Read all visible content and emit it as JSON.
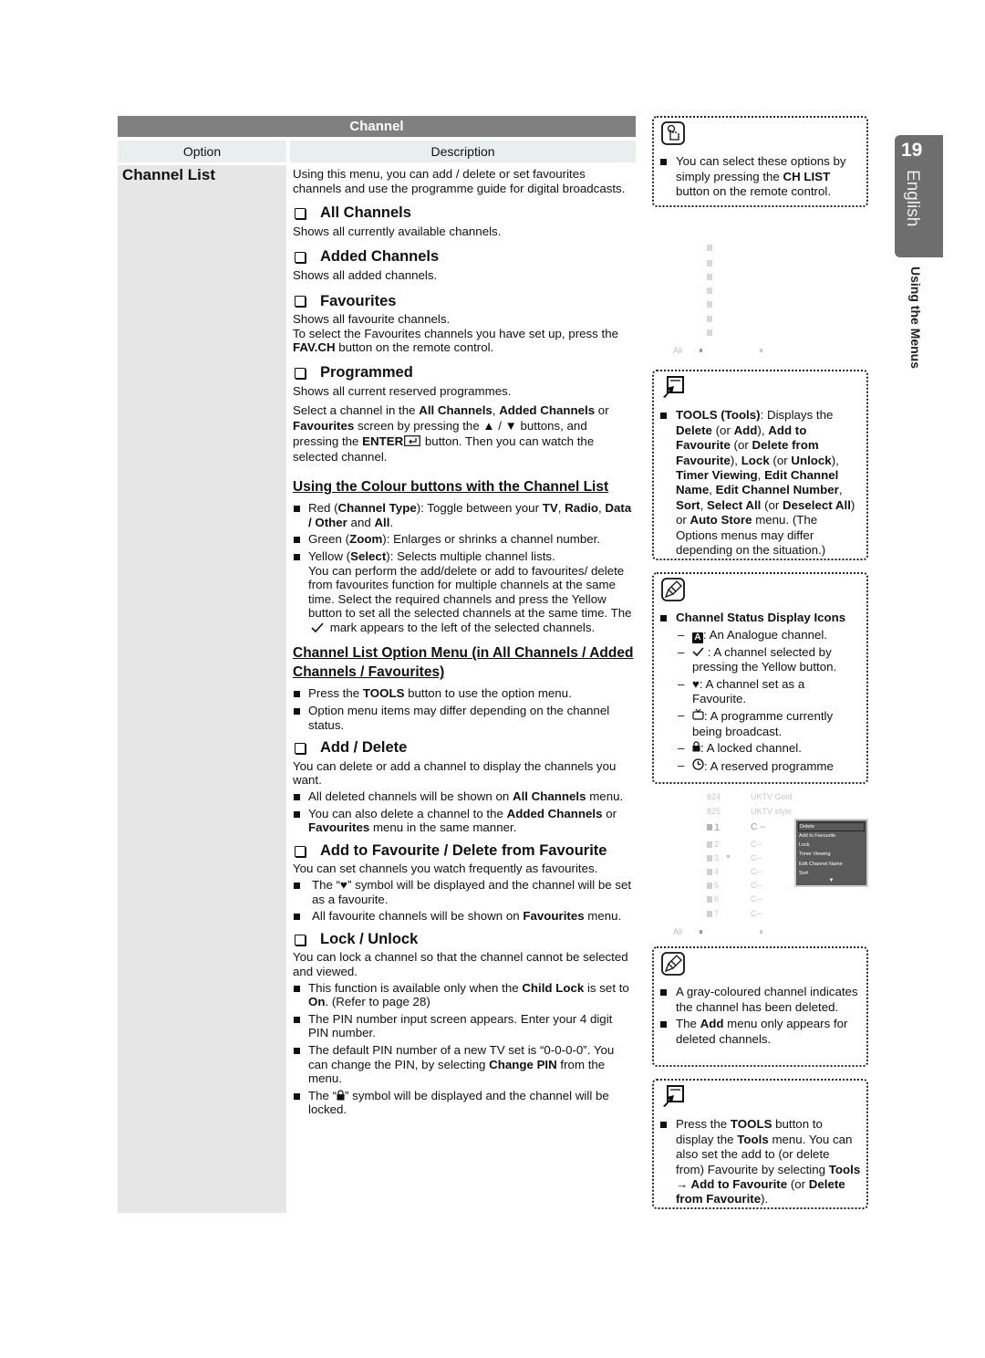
{
  "table": {
    "title": "Channel",
    "col_option": "Option",
    "col_description": "Description",
    "option": "Channel List",
    "intro": "Using this menu, you can add / delete or set favourites channels and use the programme guide for digital broadcasts."
  },
  "sections": {
    "all_channels": {
      "title": "All Channels",
      "text": "Shows all currently available channels."
    },
    "added_channels": {
      "title": "Added Channels",
      "text": "Shows all added channels."
    },
    "favourites": {
      "title": "Favourites",
      "text1": "Shows all favourite channels.",
      "text2_pre": "To select the Favourites channels you have set up, press the ",
      "text2_bold": "FAV.CH",
      "text2_post": " button on the remote control."
    },
    "programmed": {
      "title": "Programmed",
      "text1": "Shows all current reserved programmes.",
      "t2a": "Select a channel in the ",
      "t2b": "All Channels",
      "t2c": ", ",
      "t2d": "Added Channels",
      "t2e": " or ",
      "t2f": "Favourites",
      "t2g": " screen by pressing the ▲ / ▼ buttons, and pressing the ",
      "t2h": "ENTER",
      "t2i": " button. Then you can watch the selected channel."
    },
    "colour_buttons": {
      "title": "Using the Colour buttons with the Channel List",
      "red_a": "Red (",
      "red_b": "Channel Type",
      "red_c": "): Toggle between your ",
      "red_d": "TV",
      "red_e": ", ",
      "red_f": "Radio",
      "red_g": ", ",
      "red_h": "Data / Other",
      "red_i": " and ",
      "red_j": "All",
      "red_k": ".",
      "green_a": "Green (",
      "green_b": "Zoom",
      "green_c": "): Enlarges or shrinks a channel number.",
      "yellow_a": "Yellow (",
      "yellow_b": "Select",
      "yellow_c": "): Selects multiple channel lists.",
      "yellow_d": "You can perform the add/delete or add to favourites/ delete from favourites function for multiple channels at the same time. Select the required channels and press the Yellow button to set all the selected channels at the same time. The ",
      "yellow_e": " mark appears to the left of the selected channels."
    },
    "option_menu": {
      "title": "Channel List Option Menu (in All Channels / Added Channels / Favourites)",
      "b1a": "Press the ",
      "b1b": "TOOLS",
      "b1c": " button to use the option menu.",
      "b2": "Option menu items may differ depending on the channel status."
    },
    "add_delete": {
      "title": "Add / Delete",
      "text": "You can delete or add a channel to display the channels you want.",
      "b1a": "All deleted channels will be shown on ",
      "b1b": "All Channels",
      "b1c": " menu.",
      "b2a": "You can also delete a channel to the ",
      "b2b": "Added Channels",
      "b2c": " or ",
      "b2d": "Favourites",
      "b2e": " menu in the same manner."
    },
    "favourite": {
      "title": "Add to Favourite / Delete from Favourite",
      "text": "You can set channels you watch frequently as favourites.",
      "b1a": "The “",
      "b1b": "” symbol will be displayed and the channel will be set as a favourite.",
      "b2a": "All favourite channels will be shown on ",
      "b2b": "Favourites",
      "b2c": " menu."
    },
    "lock": {
      "title": "Lock / Unlock",
      "text": "You can lock a channel so that the channel cannot be selected and viewed.",
      "b1a": "This function is available only when the ",
      "b1b": "Child Lock",
      "b1c": " is set to ",
      "b1d": "On",
      "b1e": ". (Refer to page 28)",
      "b2": "The PIN number input screen appears. Enter your 4 digit PIN number.",
      "b3a": "The default PIN number of a new TV set is “0-0-0-0”. You can change the PIN, by selecting ",
      "b3b": "Change PIN",
      "b3c": " from the menu.",
      "b4a": "The “",
      "b4b": "” symbol will be displayed and the channel will be locked."
    }
  },
  "notes": {
    "remote": {
      "a": "You can select these options by simply pressing the ",
      "b": "CH LIST",
      "c": " button on the remote control."
    },
    "tools": {
      "t1": "TOOLS (Tools)",
      "t2": ": Displays the ",
      "t3": "Delete",
      "t4": " (or ",
      "t5": "Add",
      "t6": "), ",
      "t7": "Add to Favourite",
      "t8": " (or ",
      "t9": "Delete from Favourite",
      "t10": "), ",
      "t11": "Lock",
      "t12": " (or ",
      "t13": "Unlock",
      "t14": "), ",
      "t15": "Timer Viewing",
      "t16": ", ",
      "t17": "Edit Channel Name",
      "t18": ", ",
      "t19": "Edit Channel Number",
      "t20": ", ",
      "t21": "Sort",
      "t22": ", ",
      "t23": "Select All",
      "t24": " (or ",
      "t25": "Deselect All",
      "t26": ") or ",
      "t27": "Auto Store",
      "t28": " menu. (The Options menus may differ depending on the situation.)"
    },
    "status_icons": {
      "title": "Channel Status Display Icons",
      "analogue_glyph": "A",
      "analogue": ": An Analogue channel.",
      "selected": " : A channel selected by pressing the Yellow button.",
      "favourite": ": A channel set as a Favourite.",
      "broadcast": ": A programme currently being broadcast.",
      "locked": ": A locked channel.",
      "reserved": ": A reserved programme"
    },
    "gray": {
      "b1": "A gray-coloured channel indicates the channel has been deleted.",
      "b2a": "The ",
      "b2b": "Add",
      "b2c": " menu only appears for deleted channels."
    },
    "tools2": {
      "a": "Press the ",
      "b": "TOOLS",
      "c": " button to display the ",
      "d": "Tools",
      "e": " menu. You can also set the add to (or delete from) Favourite by selecting ",
      "f": "Tools → Add to Favourite",
      "g": " (or ",
      "h": "Delete from Favourite",
      "i": ")."
    }
  },
  "screen1": {
    "footer_label": "All"
  },
  "screen2": {
    "channels": [
      {
        "num": "824",
        "name": "UKTV Gold"
      },
      {
        "num": "825",
        "name": "UKTV style"
      },
      {
        "num": "1",
        "name": "C --"
      },
      {
        "num": "2",
        "name": "C--"
      },
      {
        "num": "3",
        "name": "C--"
      },
      {
        "num": "4",
        "name": "C--"
      },
      {
        "num": "5",
        "name": "C--"
      },
      {
        "num": "6",
        "name": "C--"
      },
      {
        "num": "7",
        "name": "C--"
      }
    ],
    "footer_label": "All",
    "menu": [
      "Delete",
      "Add to Favourite",
      "Lock",
      "Timer Viewing",
      "Edit Channel Name",
      "Sort"
    ],
    "menu_more": "▼"
  },
  "side": {
    "page_number": "19",
    "language": "English",
    "section": "Using the Menus"
  }
}
